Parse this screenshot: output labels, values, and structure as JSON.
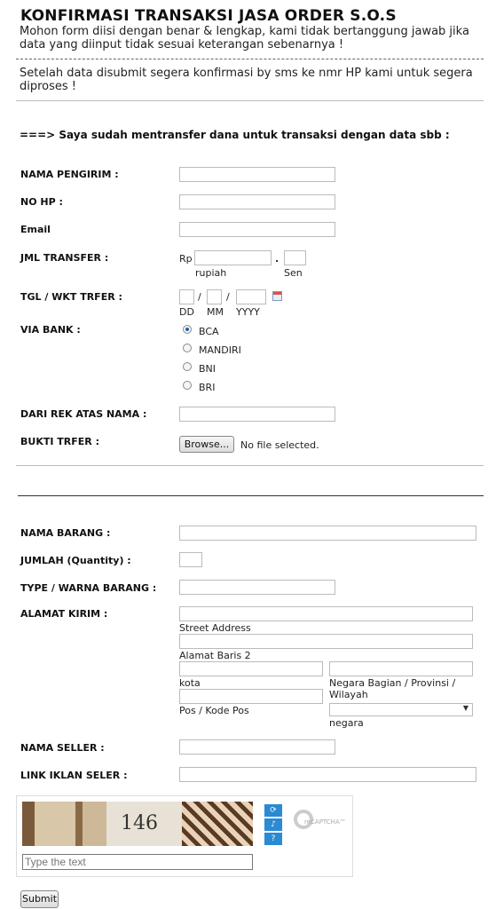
{
  "header": {
    "title": "KONFIRMASI TRANSAKSI JASA ORDER S.O.S",
    "description": "Mohon form diisi dengan benar & lengkap, kami tidak bertanggung jawab jika data yang diinput tidak sesuai keterangan sebenarnya !",
    "note": "Setelah data disubmit segera konfirmasi by sms ke nmr HP kami untuk segera diproses !"
  },
  "section1": {
    "title": "===> Saya sudah mentransfer dana untuk transaksi dengan data sbb :"
  },
  "fields": {
    "nama_pengirim": "NAMA PENGIRIM :",
    "no_hp": "NO HP :",
    "email": "Email",
    "jml_transfer": "JML TRANSFER :",
    "rp": "Rp",
    "rupiah": "rupiah",
    "dot": ".",
    "sen": "Sen",
    "tgl": "TGL / WKT TRFER :",
    "slash": "/",
    "dd": "DD",
    "mm": "MM",
    "yyyy": "YYYY",
    "via_bank": "VIA BANK :",
    "banks": [
      "BCA",
      "MANDIRI",
      "BNI",
      "BRI"
    ],
    "selected_bank": "BCA",
    "dari_rek": "DARI REK ATAS NAMA :",
    "bukti": "BUKTI TRFER :",
    "browse": "Browse...",
    "no_file": "No file selected.",
    "nama_barang": "NAMA BARANG :",
    "jumlah": "JUMLAH (Quantity) :",
    "type_warna": "TYPE / WARNA BARANG :",
    "alamat": "ALAMAT KIRIM :",
    "street": "Street Address",
    "alamat2": "Alamat Baris 2",
    "kota": "kota",
    "provinsi": "Negara Bagian / Provinsi / Wilayah",
    "pos": "Pos / Kode Pos",
    "negara": "negara",
    "nama_seller": "NAMA SELLER :",
    "link_iklan": "LINK IKLAN SELER :"
  },
  "captcha": {
    "number": "146",
    "placeholder": "Type the text",
    "brand": "reCAPTCHA™",
    "refresh_icon": "refresh-icon",
    "audio_icon": "audio-icon",
    "help_icon": "help-icon"
  },
  "submit": "Submit"
}
